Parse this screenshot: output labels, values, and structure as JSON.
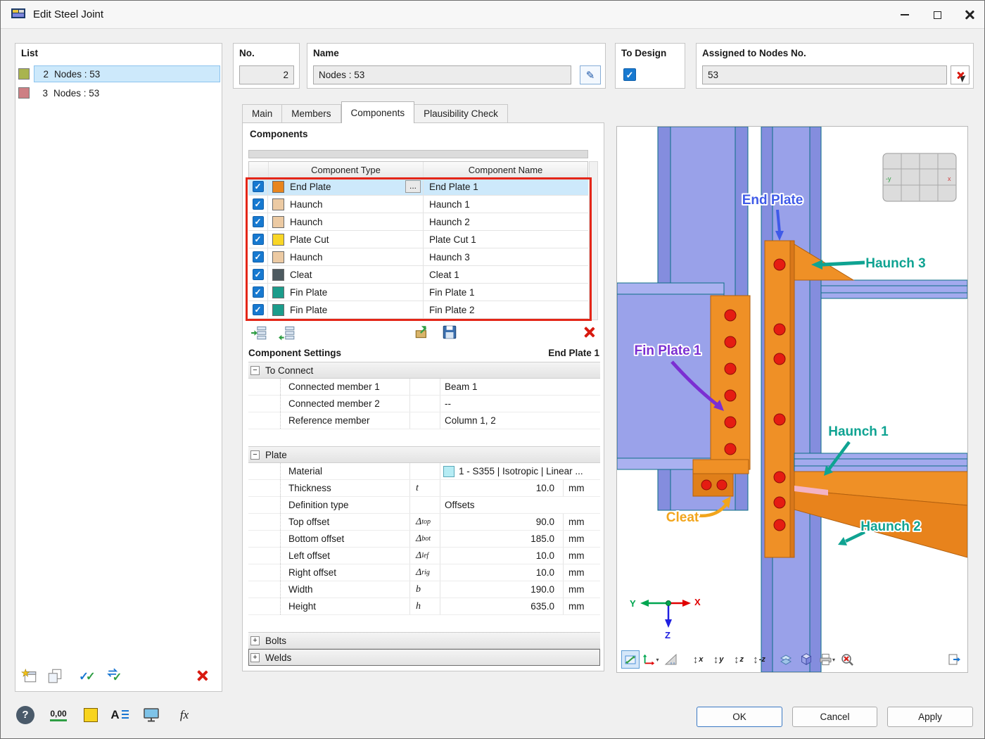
{
  "window": {
    "title": "Edit Steel Joint"
  },
  "list": {
    "title": "List",
    "items": [
      {
        "no": "2",
        "name": "Nodes : 53",
        "color": "#a9b44e",
        "selected": true
      },
      {
        "no": "3",
        "name": "Nodes : 53",
        "color": "#cd7f84",
        "selected": false
      }
    ]
  },
  "fields": {
    "no": {
      "label": "No.",
      "value": "2"
    },
    "name": {
      "label": "Name",
      "value": "Nodes : 53"
    },
    "to_design": {
      "label": "To Design",
      "checked": true
    },
    "assigned": {
      "label": "Assigned to Nodes No.",
      "value": "53"
    }
  },
  "tabs": [
    {
      "label": "Main",
      "active": false
    },
    {
      "label": "Members",
      "active": false
    },
    {
      "label": "Components",
      "active": true
    },
    {
      "label": "Plausibility Check",
      "active": false
    }
  ],
  "components": {
    "title": "Components",
    "columns": {
      "type": "Component Type",
      "name": "Component Name"
    },
    "rows": [
      {
        "checked": true,
        "type": "End Plate",
        "name": "End Plate 1",
        "color": "#e8851d",
        "selected": true,
        "options": "..."
      },
      {
        "checked": true,
        "type": "Haunch",
        "name": "Haunch 1",
        "color": "#eccaa3"
      },
      {
        "checked": true,
        "type": "Haunch",
        "name": "Haunch 2",
        "color": "#eccaa3"
      },
      {
        "checked": true,
        "type": "Plate Cut",
        "name": "Plate Cut 1",
        "color": "#f9d626"
      },
      {
        "checked": true,
        "type": "Haunch",
        "name": "Haunch 3",
        "color": "#eccaa3"
      },
      {
        "checked": true,
        "type": "Cleat",
        "name": "Cleat 1",
        "color": "#4d5a60"
      },
      {
        "checked": true,
        "type": "Fin Plate",
        "name": "Fin Plate 1",
        "color": "#1b9c8b"
      },
      {
        "checked": true,
        "type": "Fin Plate",
        "name": "Fin Plate 2",
        "color": "#1b9c8b"
      }
    ]
  },
  "settings": {
    "title": "Component Settings",
    "subtitle": "End Plate 1",
    "to_connect": {
      "label": "To Connect",
      "connected1": {
        "label": "Connected member 1",
        "value": "Beam 1"
      },
      "connected2": {
        "label": "Connected member 2",
        "value": "--"
      },
      "reference": {
        "label": "Reference member",
        "value": "Column 1, 2"
      }
    },
    "plate": {
      "label": "Plate",
      "material": {
        "label": "Material",
        "value": "1 - S355 | Isotropic | Linear ...",
        "swatch_color": "#b6ecf4"
      },
      "thickness": {
        "label": "Thickness",
        "sym": "t",
        "value": "10.0",
        "unit": "mm"
      },
      "definition": {
        "label": "Definition type",
        "value": "Offsets"
      },
      "top_offset": {
        "label": "Top offset",
        "sym": "Δ",
        "sub": "top",
        "value": "90.0",
        "unit": "mm"
      },
      "bottom_offset": {
        "label": "Bottom offset",
        "sym": "Δ",
        "sub": "bot",
        "value": "185.0",
        "unit": "mm"
      },
      "left_offset": {
        "label": "Left offset",
        "sym": "Δ",
        "sub": "lef",
        "value": "10.0",
        "unit": "mm"
      },
      "right_offset": {
        "label": "Right offset",
        "sym": "Δ",
        "sub": "rig",
        "value": "10.0",
        "unit": "mm"
      },
      "width": {
        "label": "Width",
        "sym": "b",
        "value": "190.0",
        "unit": "mm"
      },
      "height": {
        "label": "Height",
        "sym": "h",
        "value": "635.0",
        "unit": "mm"
      }
    },
    "bolts": {
      "label": "Bolts"
    },
    "welds": {
      "label": "Welds"
    }
  },
  "viewport": {
    "labels": {
      "end_plate": {
        "text": "End Plate",
        "color": "#3f5ae8"
      },
      "haunch3": {
        "text": "Haunch 3",
        "color": "#0fa392"
      },
      "fin_plate1": {
        "text": "Fin Plate 1",
        "color": "#7b2fd2"
      },
      "haunch1": {
        "text": "Haunch 1",
        "color": "#0fa392"
      },
      "cleat": {
        "text": "Cleat",
        "color": "#f2a51c"
      },
      "haunch2": {
        "text": "Haunch 2",
        "color": "#0fa392"
      }
    },
    "axes": {
      "x": "X",
      "y": "Y",
      "z": "Z"
    },
    "axis_buttons": {
      "x": "x",
      "y": "y",
      "z": "z",
      "mz": "-z"
    },
    "nav_widget": {
      "left": "-y",
      "right": "x"
    }
  },
  "footer": {
    "ok": "OK",
    "cancel": "Cancel",
    "apply": "Apply"
  },
  "icons": {
    "help": "?",
    "decimals": "0,00",
    "fonts": "A",
    "formula": "fx",
    "pencil": "✎",
    "icon_names": [
      "app-icon",
      "minimize-icon",
      "maximize-icon",
      "close-icon",
      "star-icon",
      "copy-icon",
      "check-all-icon",
      "invert-check-icon",
      "delete-cross-icon",
      "pencil-icon",
      "pick-cross-icon",
      "insert-row-icon",
      "reorder-row-icon",
      "import-icon",
      "save-icon",
      "fit-view-icon",
      "csys-icon",
      "measure-icon",
      "view-x-icon",
      "view-y-icon",
      "view-z-icon",
      "view-minus-z-icon",
      "layers-icon",
      "cube-icon",
      "printer-icon",
      "zoom-cancel-icon",
      "detach-view-icon",
      "help-icon",
      "decimals-icon",
      "colors-icon",
      "fonts-icon",
      "display-icon",
      "formula-icon"
    ]
  },
  "colors": {
    "accent": "#1779d0",
    "selection": "#cde9fb",
    "annotation": "#e42618"
  }
}
